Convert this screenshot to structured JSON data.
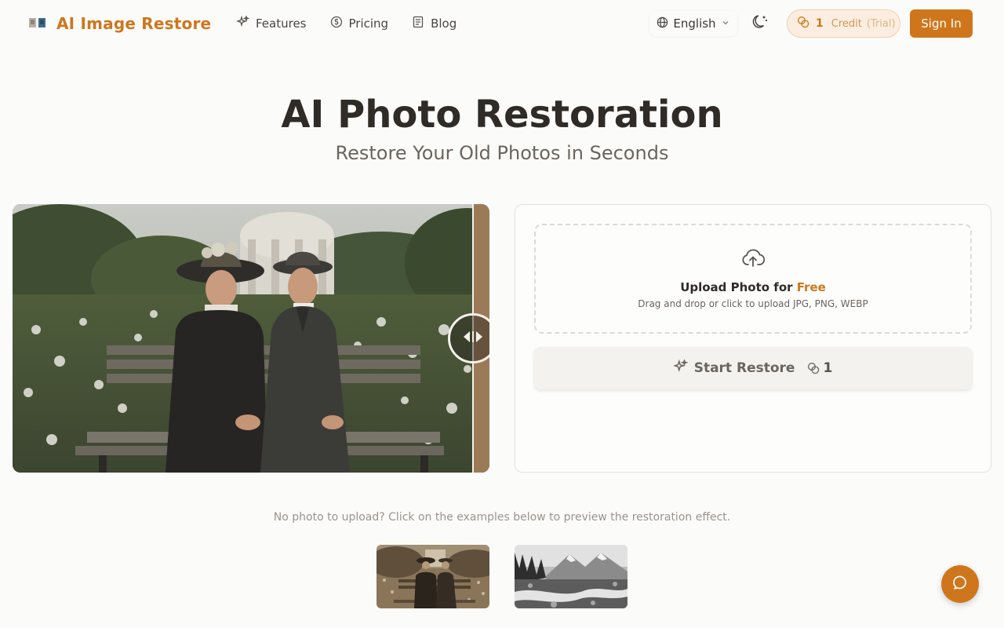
{
  "app": {
    "name": "AI Image Restore",
    "brand_color": "#cf761c"
  },
  "nav": {
    "items": [
      {
        "label": "Features",
        "icon": "sparkles-icon"
      },
      {
        "label": "Pricing",
        "icon": "coin-icon"
      },
      {
        "label": "Blog",
        "icon": "document-icon"
      }
    ]
  },
  "header": {
    "language": "English",
    "credit": {
      "count": "1",
      "label": "Credit",
      "trial": "(Trial)"
    },
    "signin_label": "Sign In"
  },
  "hero": {
    "title": "AI Photo Restoration",
    "subtitle": "Restore Your Old Photos in Seconds"
  },
  "upload": {
    "title_prefix": "Upload Photo for ",
    "title_highlight": "Free",
    "hint": "Drag and drop or click to upload JPG, PNG, WEBP",
    "restore_label": "Start Restore",
    "restore_cost": "1"
  },
  "examples": {
    "hint": "No photo to upload? Click on the examples below to preview the restoration effect.",
    "items": [
      "vintage-couple-example",
      "mountain-landscape-example"
    ]
  }
}
